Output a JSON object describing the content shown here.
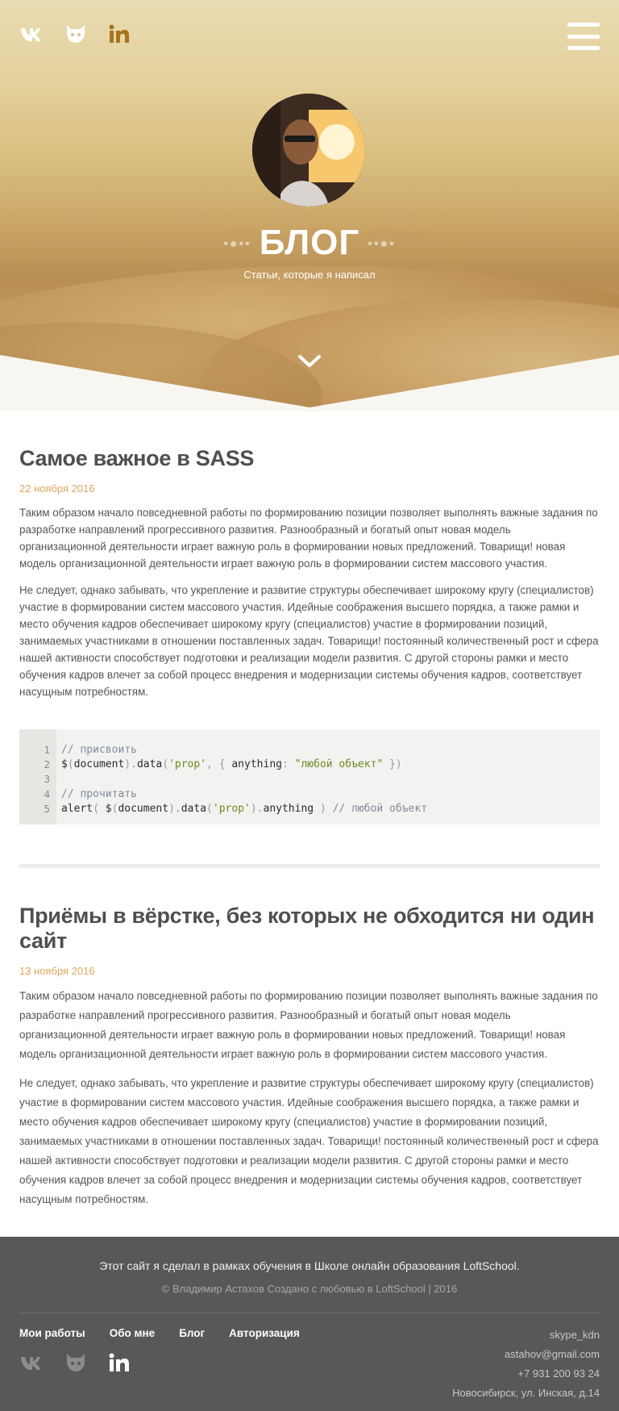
{
  "colors": {
    "accent": "#e0a55a",
    "icon_brown": "#a8741f",
    "footer_bg": "#56585a"
  },
  "header": {
    "social": [
      {
        "name": "vk-icon"
      },
      {
        "name": "github-icon"
      },
      {
        "name": "linkedin-icon"
      }
    ],
    "menu_icon": "hamburger-menu-icon"
  },
  "hero": {
    "title": "БЛОГ",
    "subtitle": "Статьи, которые я написал",
    "scroll_icon": "chevron-down-icon"
  },
  "articles": [
    {
      "title": "Самое важное в SASS",
      "date": "22 ноября 2016",
      "paragraphs": [
        "Таким образом начало повседневной работы по формированию позиции позволяет выполнять важные задания по разработке направлений прогрессивного развития. Разнообразный и богатый опыт новая модель организационной деятельности играет важную роль в формировании новых предложений. Товарищи! новая модель организационной деятельности играет важную роль в формировании систем массового участия.",
        "Не следует, однако забывать, что укрепление и развитие структуры обеспечивает широкому кругу (специалистов) участие в формировании систем массового участия. Идейные соображения высшего порядка, а также рамки и место обучения кадров обеспечивает широкому кругу (специалистов) участие в формировании позиций, занимаемых участниками в отношении поставленных задач. Товарищи! постоянный количественный рост и сфера нашей активности способствует подготовки и реализации модели развития. С другой стороны рамки и место обучения кадров влечет за собой процесс внедрения и модернизации системы обучения кадров, соответствует насущным потребностям."
      ],
      "code": {
        "line_numbers": [
          "1",
          "2",
          "3",
          "4",
          "5"
        ],
        "l1_comment": "// присвоить",
        "l2_a": "$",
        "l2_b": "(",
        "l2_c": "document",
        "l2_d": ").",
        "l2_e": "data",
        "l2_f": "(",
        "l2_g": "'prop'",
        "l2_h": ", { ",
        "l2_i": "anything",
        "l2_j": ": ",
        "l2_k": "\"любой объект\"",
        "l2_l": " })",
        "l4_comment": "// прочитать",
        "l5_a": "alert",
        "l5_b": "( ",
        "l5_c": "$",
        "l5_d": "(",
        "l5_e": "document",
        "l5_f": ").",
        "l5_g": "data",
        "l5_h": "(",
        "l5_i": "'prop'",
        "l5_j": ").",
        "l5_k": "anything",
        "l5_l": " ) ",
        "l5_m": "// любой объект"
      }
    },
    {
      "title": "Приёмы в вёрстке, без которых не обходится ни один сайт",
      "date": "13 ноября 2016",
      "paragraphs": [
        "Таким образом начало повседневной работы по формированию позиции позволяет выполнять важные задания по разработке направлений прогрессивного развития. Разнообразный и богатый опыт новая модель организационной деятельности играет важную роль в формировании новых предложений. Товарищи! новая модель организационной деятельности играет важную роль в формировании систем массового участия.",
        "Не следует, однако забывать, что укрепление и развитие структуры обеспечивает широкому кругу (специалистов) участие в формировании систем массового участия. Идейные соображения высшего порядка, а также рамки и место обучения кадров обеспечивает широкому кругу (специалистов) участие в формировании позиций, занимаемых участниками в отношении поставленных задач. Товарищи! постоянный количественный рост и сфера нашей активности способствует подготовки и реализации модели развития. С другой стороны рамки и место обучения кадров влечет за собой процесс внедрения и модернизации системы обучения кадров, соответствует насущным потребностям."
      ]
    }
  ],
  "footer": {
    "line1": "Этот сайт я сделал в рамках обучения в Школе онлайн образования LoftSchool.",
    "line2": "© Владимир Астахов Создано с любовью в LoftSchool | 2016",
    "nav": [
      "Мои работы",
      "Обо мне",
      "Блог",
      "Авторизация"
    ],
    "contacts": [
      "skype_kdn",
      "astahov@gmail.com",
      "+7 931 200 93 24",
      "Новосибирск, ул. Инская, д.14"
    ]
  }
}
